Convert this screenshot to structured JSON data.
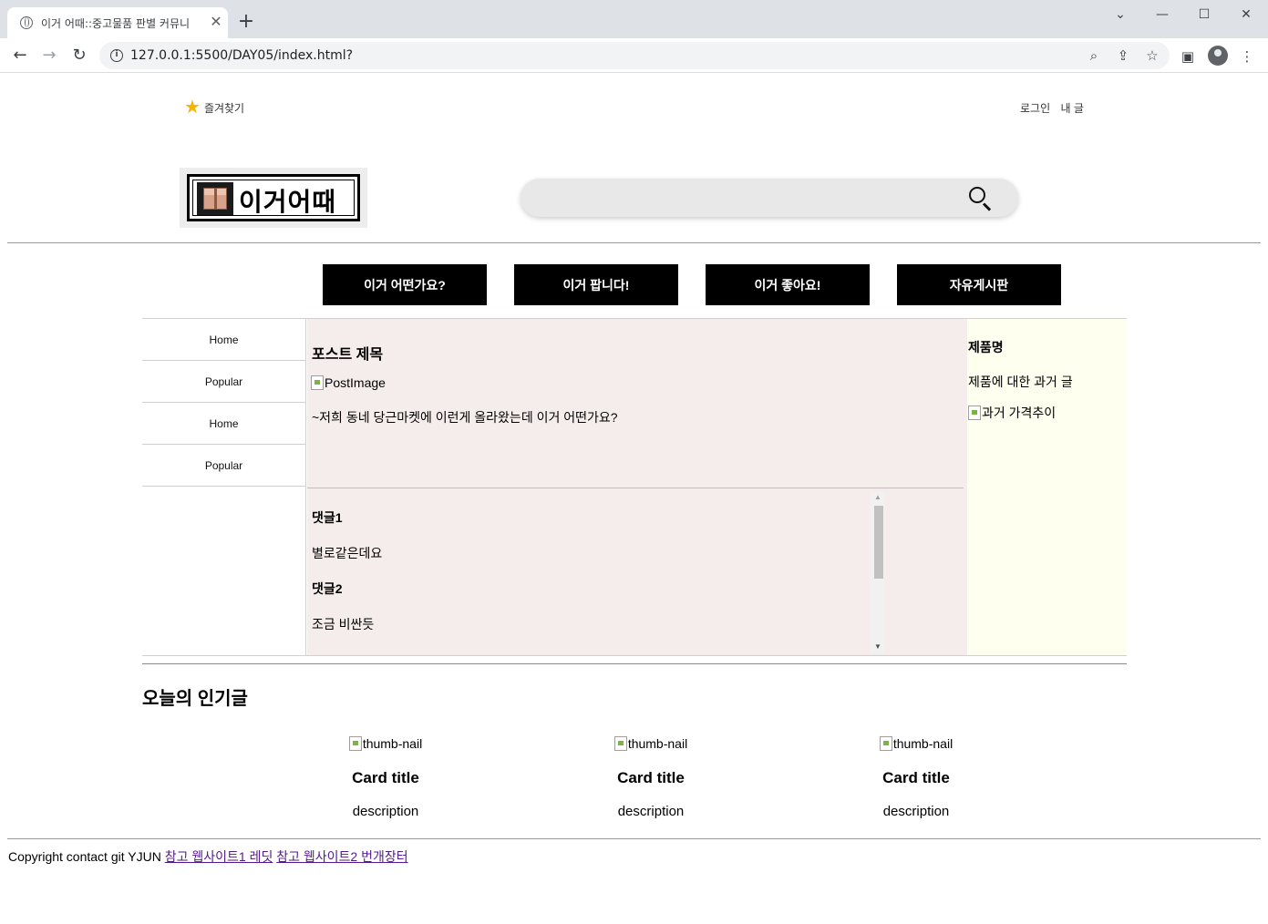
{
  "browser": {
    "tab_title": "이거 어때::중고물품 판별 커뮤니",
    "url": "127.0.0.1:5500/DAY05/index.html?"
  },
  "header": {
    "favorites_label": "즐겨찾기",
    "login_label": "로그인",
    "my_posts_label": "내 글",
    "logo_text": "이거어때",
    "search_placeholder": ""
  },
  "nav": {
    "items": [
      {
        "label": "이거 어떤가요?"
      },
      {
        "label": "이거 팝니다!"
      },
      {
        "label": "이거 좋아요!"
      },
      {
        "label": "자유게시판"
      }
    ]
  },
  "sidebar": {
    "items": [
      {
        "label": "Home"
      },
      {
        "label": "Popular"
      },
      {
        "label": "Home"
      },
      {
        "label": "Popular"
      }
    ]
  },
  "post": {
    "title": "포스트 제목",
    "image_alt": "PostImage",
    "body": "~저희 동네 당근마켓에 이런게 올라왔는데 이거 어떤가요?",
    "comments": [
      {
        "author": "댓글1",
        "text": "별로같은데요"
      },
      {
        "author": "댓글2",
        "text": "조금 비싼듯"
      }
    ]
  },
  "product": {
    "name": "제품명",
    "description": "제품에 대한 과거 글",
    "image_alt": "과거 가격추이"
  },
  "popular": {
    "title": "오늘의 인기글",
    "cards": [
      {
        "thumb_alt": "thumb-nail",
        "title": "Card title",
        "description": "description"
      },
      {
        "thumb_alt": "thumb-nail",
        "title": "Card title",
        "description": "description"
      },
      {
        "thumb_alt": "thumb-nail",
        "title": "Card title",
        "description": "description"
      }
    ]
  },
  "footer": {
    "text": "Copyright contact git YJUN",
    "link1": "참고 웹사이트1 레딧",
    "link2": "참고 웹사이트2 번개장터"
  },
  "colors": {
    "nav_bg": "#000000",
    "post_bg": "#f5edeb",
    "product_bg": "#fffff0",
    "search_bg": "#e8e8e8",
    "star": "#f5b400"
  }
}
